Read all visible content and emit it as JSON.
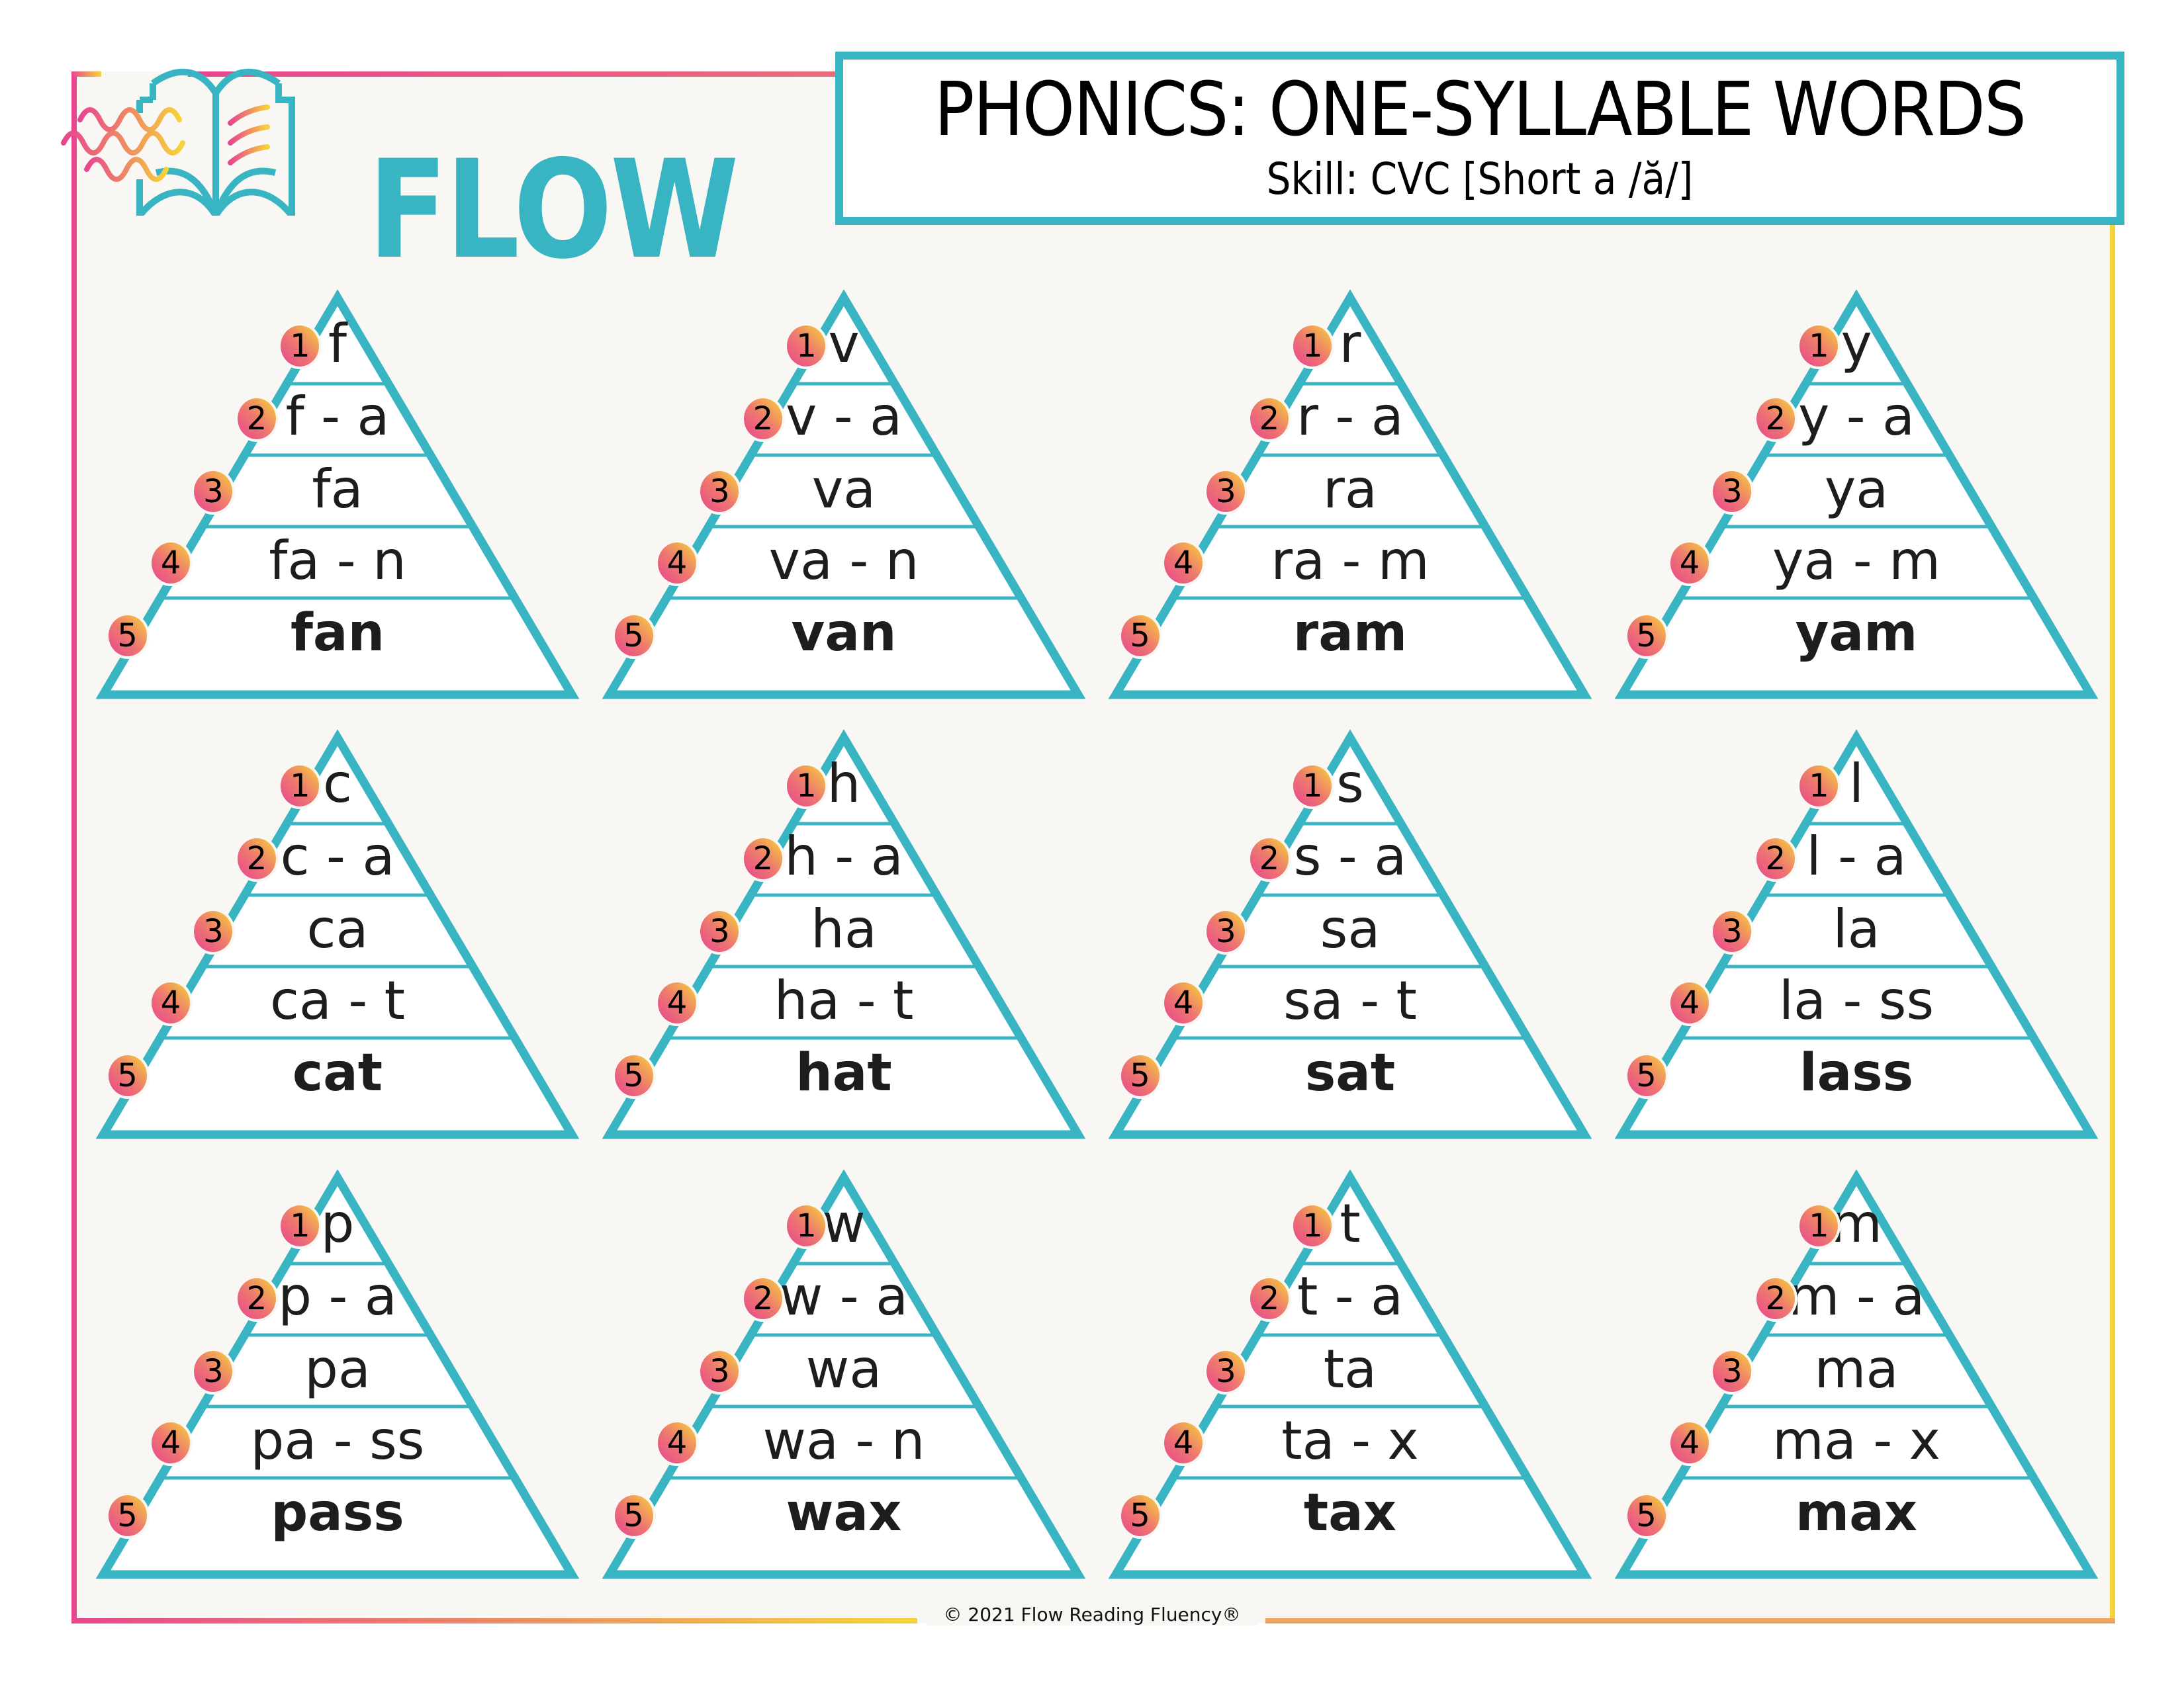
{
  "logo": {
    "text": "FLOW",
    "icon": "open-book-icon"
  },
  "header": {
    "title": "PHONICS: ONE-SYLLABLE WORDS",
    "subtitle": "Skill: CVC [Short a  /ă/]"
  },
  "colors": {
    "teal": "#39b4c3",
    "pink": "#e8468f",
    "orange": "#ee8a64",
    "yellow": "#f6d33a",
    "background": "#f8f7f3"
  },
  "pyramids": [
    {
      "rows": [
        "f",
        "f - a",
        "fa",
        "fa - n",
        "fan"
      ]
    },
    {
      "rows": [
        "v",
        "v - a",
        "va",
        "va - n",
        "van"
      ]
    },
    {
      "rows": [
        "r",
        "r - a",
        "ra",
        "ra - m",
        "ram"
      ]
    },
    {
      "rows": [
        "y",
        "y - a",
        "ya",
        "ya - m",
        "yam"
      ]
    },
    {
      "rows": [
        "c",
        "c - a",
        "ca",
        "ca - t",
        "cat"
      ]
    },
    {
      "rows": [
        "h",
        "h - a",
        "ha",
        "ha - t",
        "hat"
      ]
    },
    {
      "rows": [
        "s",
        "s - a",
        "sa",
        "sa - t",
        "sat"
      ]
    },
    {
      "rows": [
        "l",
        "l - a",
        "la",
        "la - ss",
        "lass"
      ]
    },
    {
      "rows": [
        "p",
        "p - a",
        "pa",
        "pa - ss",
        "pass"
      ]
    },
    {
      "rows": [
        "w",
        "w - a",
        "wa",
        "wa - n",
        "wax"
      ]
    },
    {
      "rows": [
        "t",
        "t - a",
        "ta",
        "ta - x",
        "tax"
      ]
    },
    {
      "rows": [
        "m",
        "m - a",
        "ma",
        "ma - x",
        "max"
      ]
    }
  ],
  "step_numbers": [
    "1",
    "2",
    "3",
    "4",
    "5"
  ],
  "footer": {
    "copyright": "© 2021 Flow Reading Fluency®"
  }
}
